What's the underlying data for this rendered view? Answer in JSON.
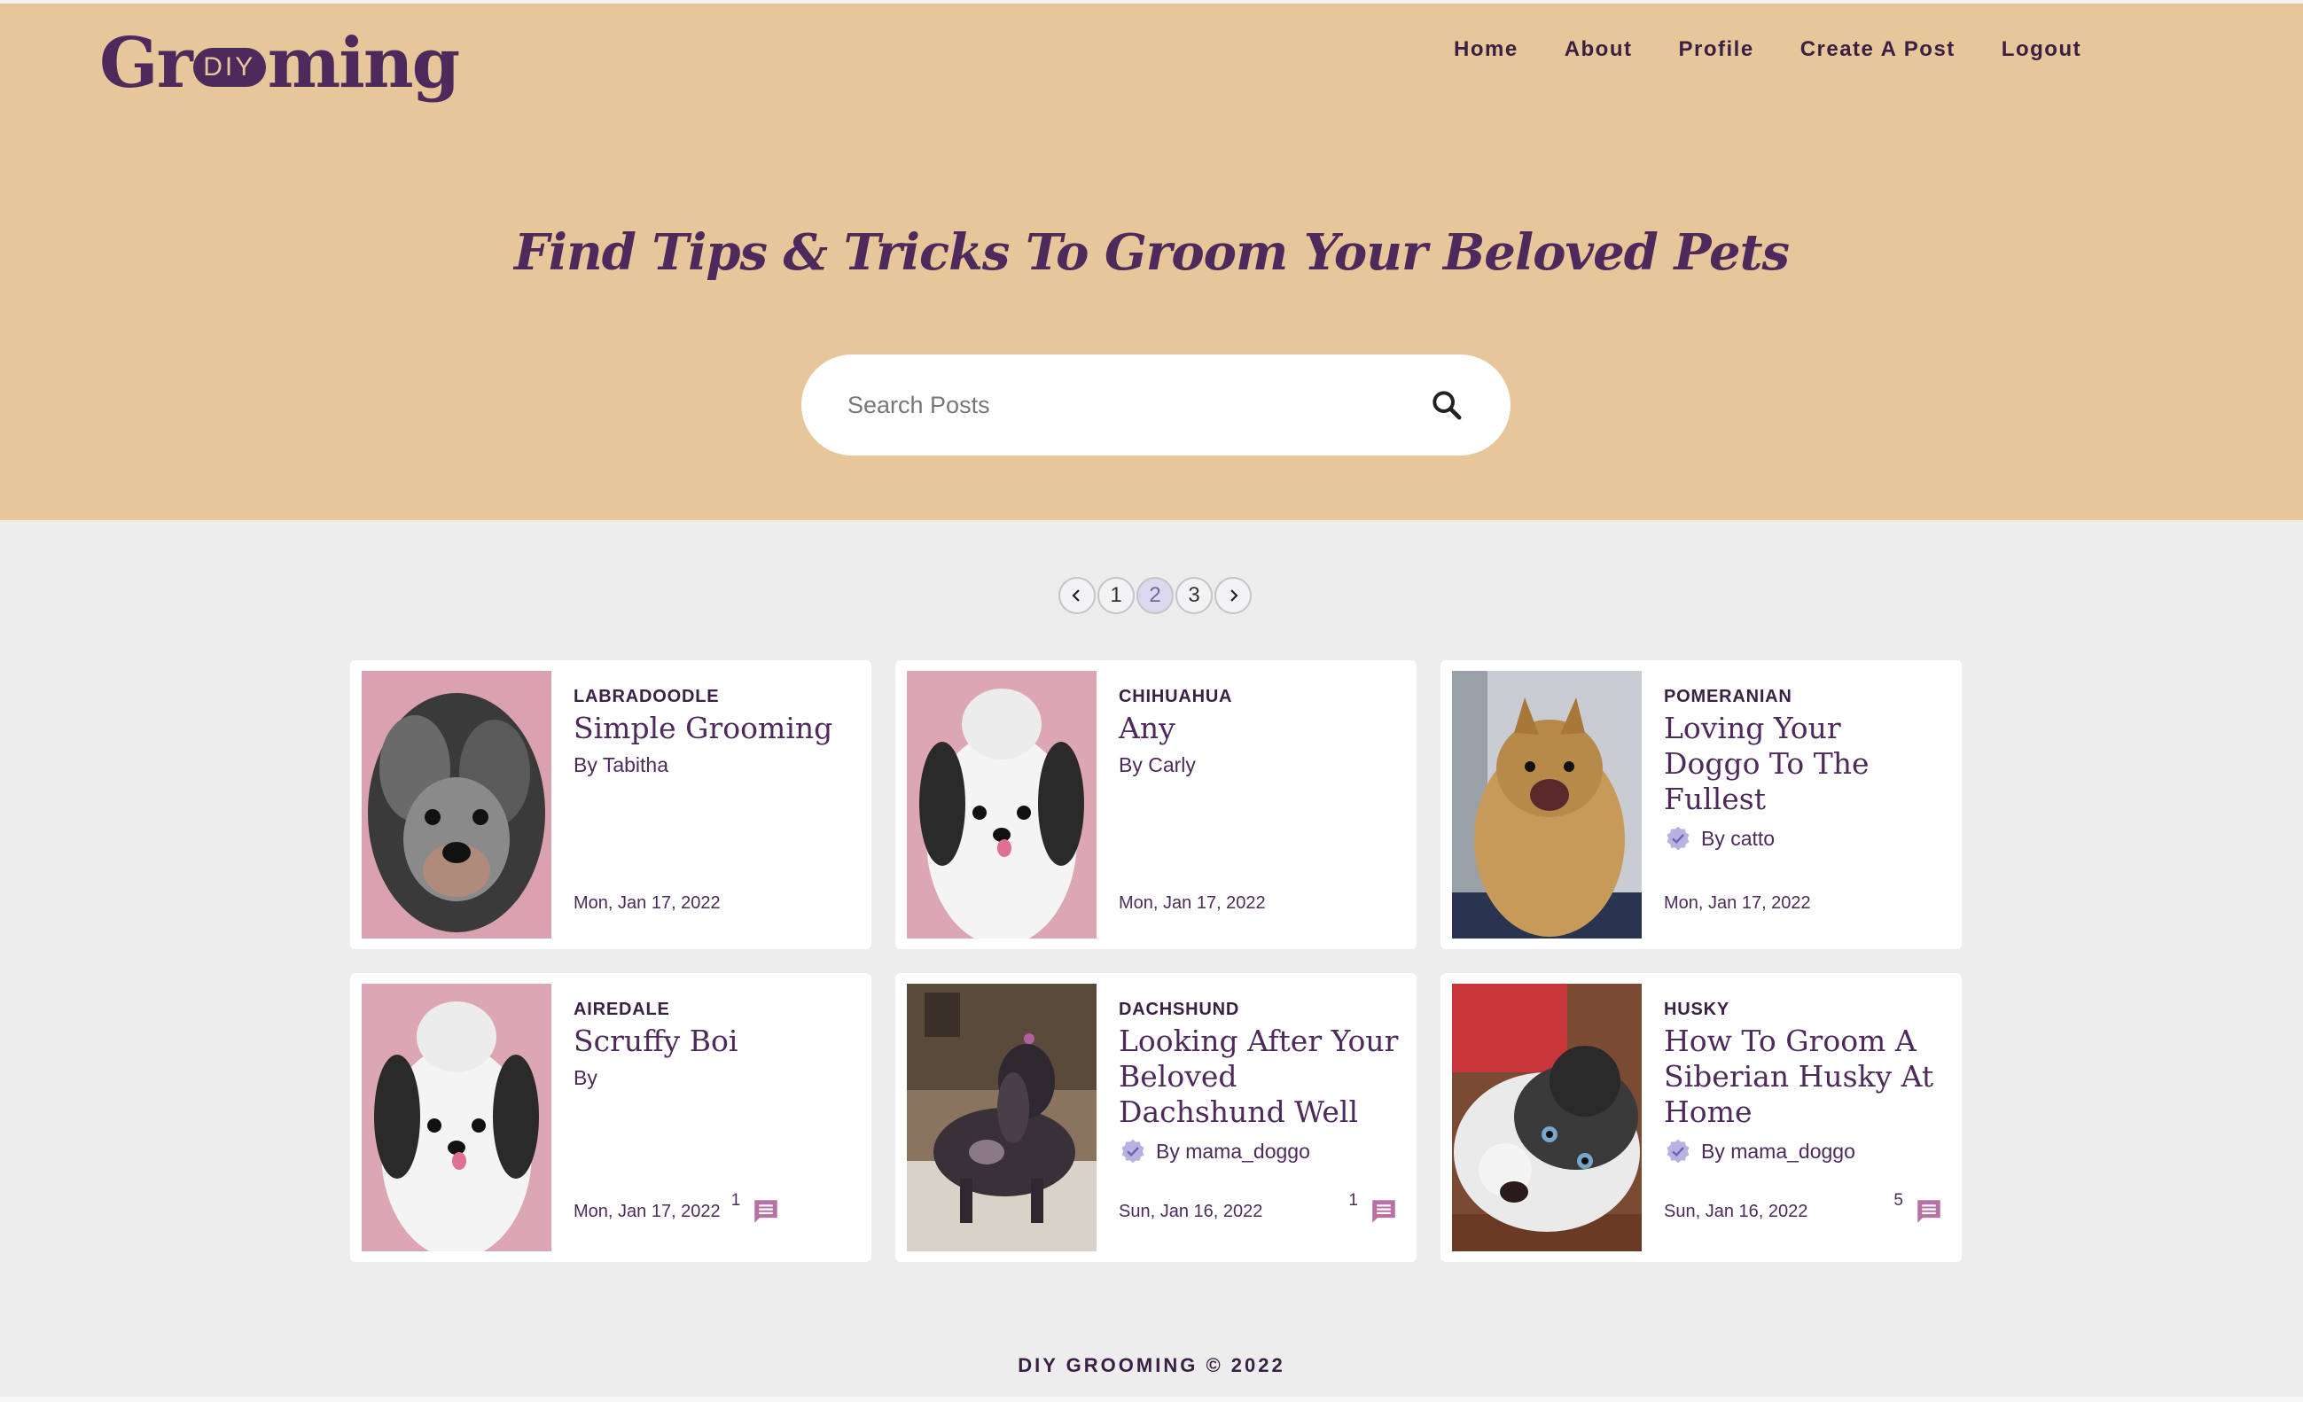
{
  "brand": {
    "logo_pre": "Gr",
    "logo_pill": "DIY",
    "logo_post": "ming"
  },
  "nav": {
    "home": "Home",
    "about": "About",
    "profile": "Profile",
    "create": "Create A Post",
    "logout": "Logout"
  },
  "hero": {
    "headline": "Find Tips & Tricks To Groom Your Beloved Pets"
  },
  "search": {
    "placeholder": "Search Posts"
  },
  "pagination": {
    "pages": [
      "1",
      "2",
      "3"
    ],
    "current": "2"
  },
  "posts": [
    {
      "breed": "LABRADOODLE",
      "title": "Simple Grooming",
      "author": "By Tabitha",
      "verified": false,
      "date": "Mon, Jan 17, 2022",
      "comments": ""
    },
    {
      "breed": "CHIHUAHUA",
      "title": "Any",
      "author": "By Carly",
      "verified": false,
      "date": "Mon, Jan 17, 2022",
      "comments": ""
    },
    {
      "breed": "POMERANIAN",
      "title": "Loving Your Doggo To The Fullest",
      "author": "By catto",
      "verified": true,
      "date": "Mon, Jan 17, 2022",
      "comments": ""
    },
    {
      "breed": "AIREDALE",
      "title": "Scruffy Boi",
      "author": "By",
      "verified": false,
      "date": "Mon, Jan 17, 2022",
      "comments": "1"
    },
    {
      "breed": "DACHSHUND",
      "title": "Looking After Your Beloved Dachshund Well",
      "author": "By mama_doggo",
      "verified": true,
      "date": "Sun, Jan 16, 2022",
      "comments": "1"
    },
    {
      "breed": "HUSKY",
      "title": "How To Groom A Siberian Husky At Home",
      "author": "By mama_doggo",
      "verified": true,
      "date": "Sun, Jan 16, 2022",
      "comments": "5"
    }
  ],
  "footer": {
    "text": "DIY GROOMING © 2022"
  },
  "colors": {
    "hero_bg": "#e7c699",
    "brand_purple": "#4d2a5b",
    "page_bg": "#eeeded",
    "accent_pink": "#b871a6"
  },
  "icons": {
    "search": "search-icon",
    "prev": "chevron-left-icon",
    "next": "chevron-right-icon",
    "verified": "verified-badge-icon",
    "comment": "comment-icon"
  }
}
